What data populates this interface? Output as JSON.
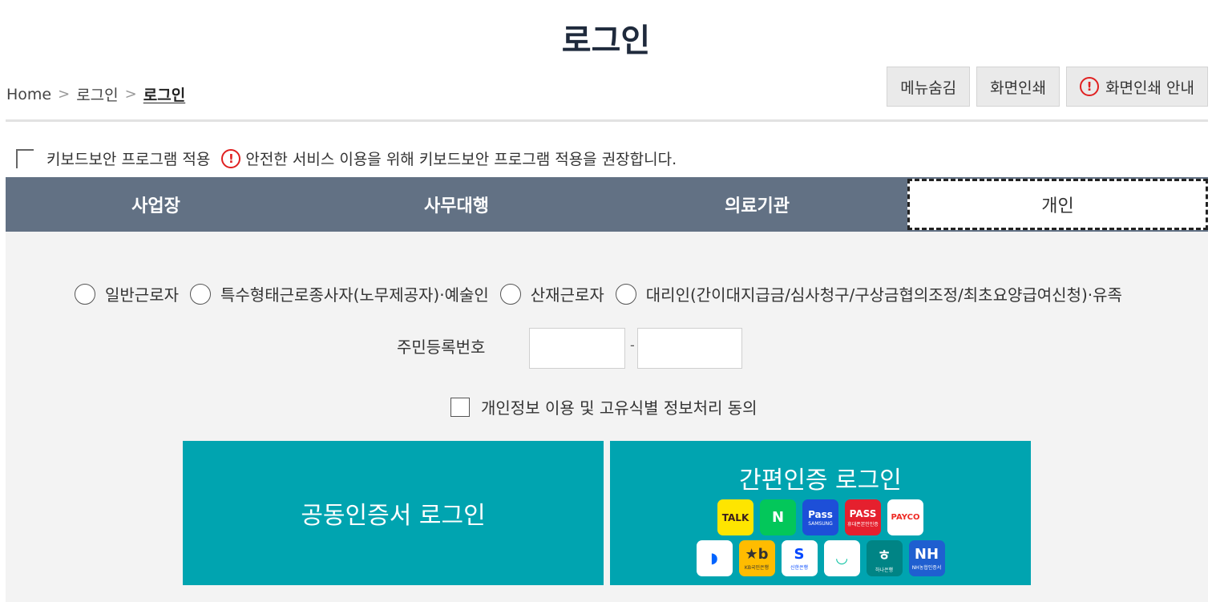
{
  "page": {
    "title": "로그인"
  },
  "breadcrumb": {
    "home": "Home",
    "level1": "로그인",
    "current": "로그인"
  },
  "top_buttons": {
    "hide_menu": "메뉴숨김",
    "print": "화면인쇄",
    "print_guide": "화면인쇄 안내"
  },
  "keyboard_security": {
    "label": "키보드보안 프로그램 적용",
    "notice": "안전한 서비스 이용을 위해 키보드보안 프로그램 적용을 권장합니다."
  },
  "tabs": [
    {
      "label": "사업장",
      "active": false
    },
    {
      "label": "사무대행",
      "active": false
    },
    {
      "label": "의료기관",
      "active": false
    },
    {
      "label": "개인",
      "active": true
    }
  ],
  "user_types": [
    {
      "label": "일반근로자"
    },
    {
      "label": "특수형태근로종사자(노무제공자)·예술인"
    },
    {
      "label": "산재근로자"
    },
    {
      "label": "대리인(간이대지급금/심사청구/구상금협의조정/최초요양급여신청)·유족"
    }
  ],
  "resident_number": {
    "label": "주민등록번호",
    "separator": "-",
    "front_value": "",
    "back_value": ""
  },
  "agreement": {
    "label": "개인정보 이용 및 고유식별 정보처리 동의"
  },
  "login": {
    "certificate": "공동인증서 로그인",
    "easy_auth": "간편인증 로그인"
  },
  "easy_auth_providers": {
    "row1": [
      {
        "icon": "kakaotalk-icon",
        "text": "TALK",
        "sub": "",
        "bg": "#fee500",
        "fg": "#3a1d1d"
      },
      {
        "icon": "naver-icon",
        "text": "N",
        "sub": "",
        "bg": "#03c75a",
        "fg": "#ffffff"
      },
      {
        "icon": "samsung-pass-icon",
        "text": "Pass",
        "sub": "SAMSUNG",
        "bg": "#1d4fd8",
        "fg": "#ffffff"
      },
      {
        "icon": "pass-icon",
        "text": "PASS",
        "sub": "휴대폰본인인증",
        "bg": "#e5202e",
        "fg": "#ffffff"
      },
      {
        "icon": "payco-icon",
        "text": "PAYCO",
        "sub": "",
        "bg": "#ffffff",
        "fg": "#ee2a24"
      }
    ],
    "row2": [
      {
        "icon": "toss-icon",
        "text": "◗",
        "sub": "",
        "bg": "#ffffff",
        "fg": "#0064ff"
      },
      {
        "icon": "kb-icon",
        "text": "★b",
        "sub": "KB국민은행",
        "bg": "#ffbc00",
        "fg": "#333333"
      },
      {
        "icon": "shinhan-icon",
        "text": "S",
        "sub": "신한은행",
        "bg": "#ffffff",
        "fg": "#0046ff"
      },
      {
        "icon": "banksalad-icon",
        "text": "◡",
        "sub": "",
        "bg": "#ffffff",
        "fg": "#00c09e"
      },
      {
        "icon": "hana-icon",
        "text": "ㅎ",
        "sub": "하나은행",
        "bg": "#008485",
        "fg": "#ffffff"
      },
      {
        "icon": "nh-icon",
        "text": "NH",
        "sub": "NH농협인증서",
        "bg": "#1f5fd0",
        "fg": "#ffffff"
      }
    ]
  }
}
